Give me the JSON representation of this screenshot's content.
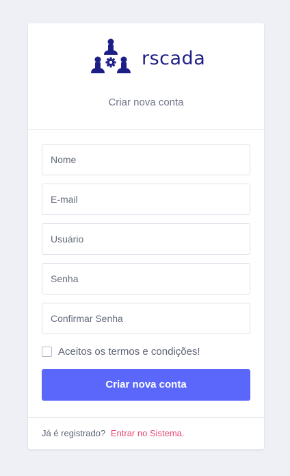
{
  "brand": {
    "name": "rscada",
    "color": "#1d1f86"
  },
  "header": {
    "subtitle": "Criar nova conta"
  },
  "form": {
    "name_placeholder": "Nome",
    "email_placeholder": "E-mail",
    "username_placeholder": "Usuário",
    "password_placeholder": "Senha",
    "confirm_password_placeholder": "Confirmar Senha",
    "terms_label": "Aceitos os termos e condições!",
    "terms_checked": false,
    "submit_label": "Criar nova conta",
    "submit_color": "#5a67fa"
  },
  "footer": {
    "prompt": "Já é registrado?",
    "link_label": "Entrar no Sistema.",
    "link_color": "#e64672"
  },
  "icons": {
    "logo": "scada-people-gear-icon",
    "checkbox": "checkbox-unchecked"
  }
}
